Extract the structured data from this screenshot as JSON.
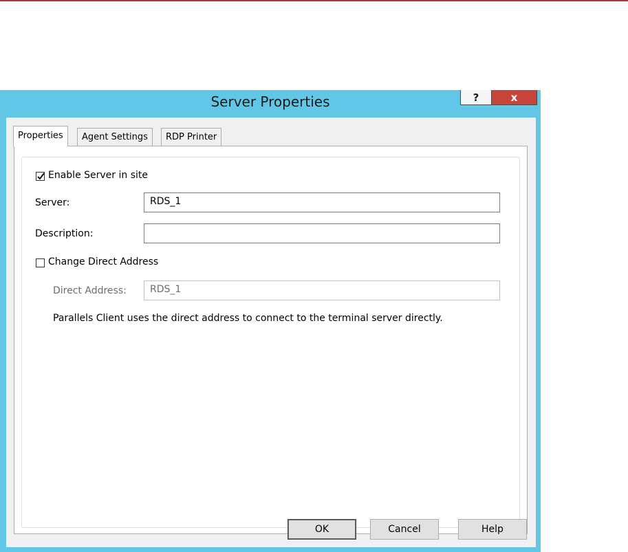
{
  "window": {
    "title": "Server Properties",
    "help_label": "?",
    "close_label": "x"
  },
  "tabs": [
    {
      "label": "Properties",
      "active": true
    },
    {
      "label": "Agent Settings",
      "active": false
    },
    {
      "label": "RDP Printer",
      "active": false
    }
  ],
  "form": {
    "enable_server": {
      "label": "Enable Server in site",
      "checked": true
    },
    "server": {
      "label": "Server:",
      "value": "RDS_1"
    },
    "description": {
      "label": "Description:",
      "value": ""
    },
    "change_direct_address": {
      "label": "Change Direct Address",
      "checked": false
    },
    "direct_address": {
      "label": "Direct Address:",
      "value": "RDS_1",
      "enabled": false
    },
    "info_text": "Parallels Client uses the direct address to connect to the terminal server directly."
  },
  "buttons": {
    "ok": "OK",
    "cancel": "Cancel",
    "help": "Help"
  },
  "colors": {
    "titlebar": "#62c7e6",
    "close_button": "#c6443a",
    "top_rule": "#a6384a"
  }
}
